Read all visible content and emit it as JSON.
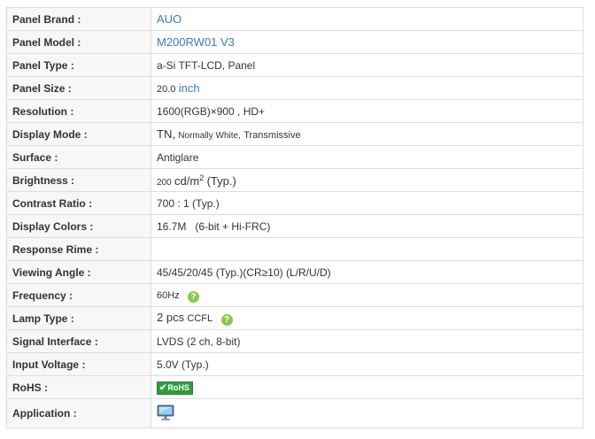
{
  "rows": [
    {
      "label": "Panel Brand :",
      "value": "AUO"
    },
    {
      "label": "Panel Model :",
      "value": "M200RW01 V3"
    },
    {
      "label": "Panel Type :",
      "value": "a-Si TFT-LCD, Panel"
    },
    {
      "label": "Panel Size :",
      "value_num": "20.0",
      "value_unit": "inch"
    },
    {
      "label": "Resolution :",
      "value": "1600(RGB)×900 , HD+"
    },
    {
      "label": "Display Mode :",
      "value_a": "TN,",
      "value_b": "Normally White,",
      "value_c": "Transmissive"
    },
    {
      "label": "Surface :",
      "value": "Antiglare"
    },
    {
      "label": "Brightness :",
      "value_a": "200",
      "value_b": "cd/m",
      "value_sup": "2",
      "value_c": "(Typ.)"
    },
    {
      "label": "Contrast Ratio :",
      "value": "700 : 1 (Typ.)"
    },
    {
      "label": "Display Colors :",
      "value": "16.7M   (6-bit + Hi-FRC)"
    },
    {
      "label": "Response Rime :",
      "value": ""
    },
    {
      "label": "Viewing Angle :",
      "value": "45/45/20/45 (Typ.)(CR≥10) (L/R/U/D)"
    },
    {
      "label": "Frequency :",
      "value": "60Hz",
      "help": "?"
    },
    {
      "label": "Lamp Type :",
      "value_a": "2 pcs",
      "value_b": "CCFL",
      "help": "?"
    },
    {
      "label": "Signal Interface :",
      "value": "LVDS (2 ch, 8-bit)"
    },
    {
      "label": "Input Voltage :",
      "value": "5.0V (Typ.)"
    },
    {
      "label": "RoHS :",
      "badge": "RoHS",
      "badge_check": "✔"
    },
    {
      "label": "Application :",
      "icon": "monitor-icon"
    }
  ]
}
